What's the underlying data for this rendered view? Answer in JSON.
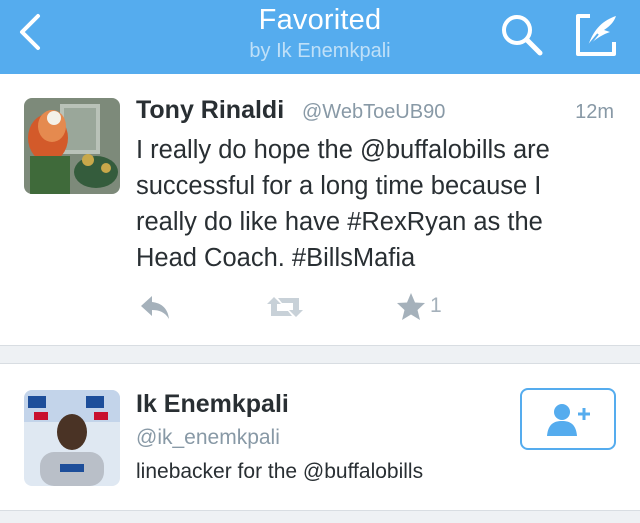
{
  "header": {
    "title": "Favorited",
    "subtitle": "by Ik Enemkpali",
    "back_icon": "chevron-left-icon",
    "search_icon": "search-icon",
    "compose_icon": "compose-quill-icon",
    "bar_color": "#55acee"
  },
  "tweet": {
    "author_name": "Tony Rinaldi",
    "author_handle": "@WebToeUB90",
    "time": "12m",
    "text_lines": [
      "I really do hope the @buffalobills are",
      "successful for a long time because I",
      "really do like have #RexRyan as the",
      "Head Coach.  #BillsMafia"
    ],
    "actions": {
      "reply_icon": "reply-icon",
      "retweet_icon": "retweet-icon",
      "favorite_icon": "star-icon",
      "favorite_count": "1"
    }
  },
  "user": {
    "name": "Ik Enemkpali",
    "handle": "@ik_enemkpali",
    "bio": "linebacker for the @buffalobills",
    "follow_icon": "add-user-icon"
  },
  "colors": {
    "accent": "#55acee",
    "text_primary": "#292f33",
    "text_secondary": "#8899a6",
    "action_gray": "#a5b1bb"
  }
}
